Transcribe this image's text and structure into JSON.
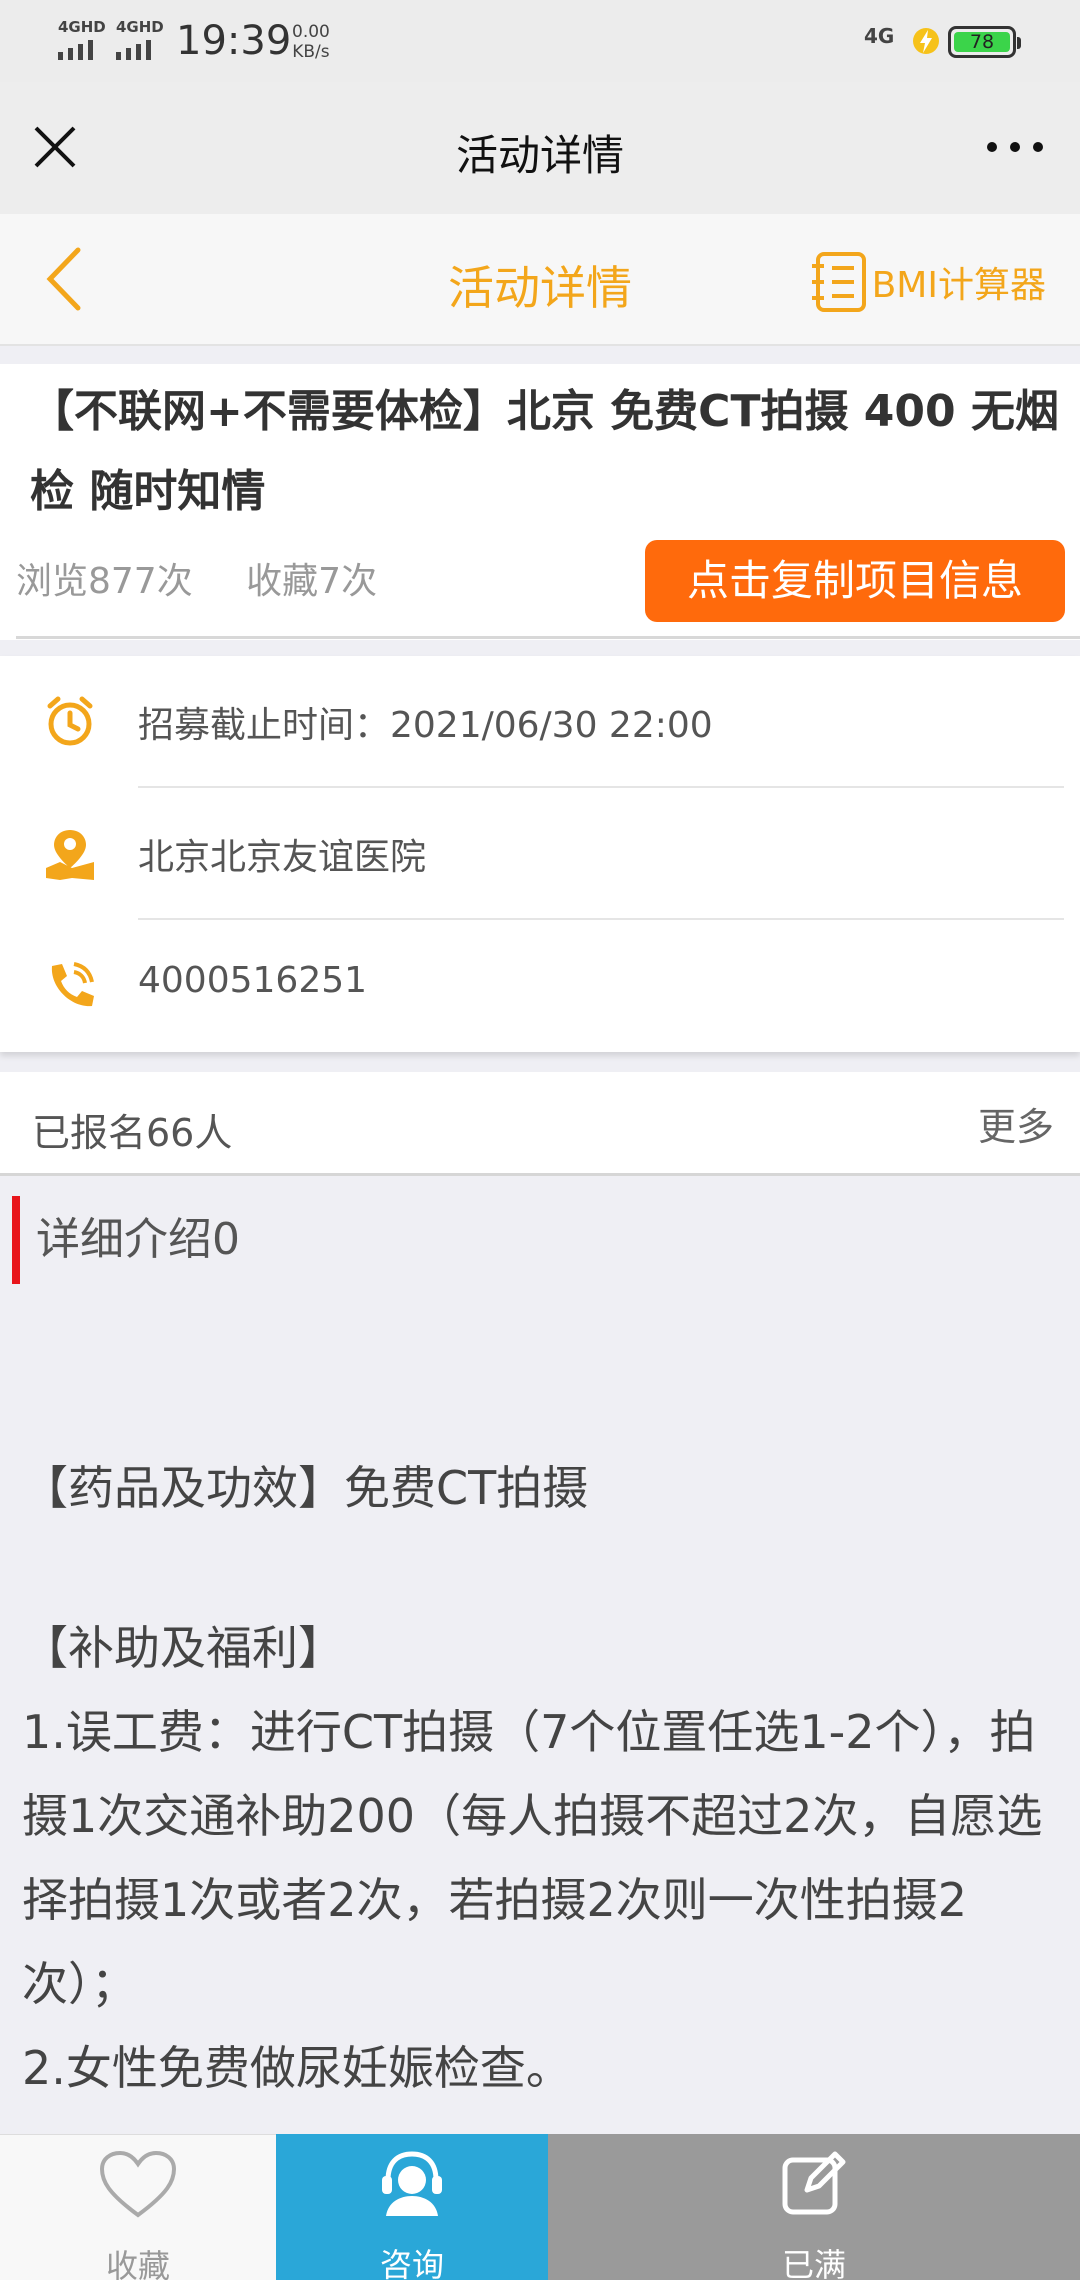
{
  "status": {
    "sim1": "4GHD",
    "sim2": "4GHD",
    "time": "19:39",
    "speed_value": "0.00",
    "speed_unit": "KB/s",
    "network": "4G",
    "battery": "78"
  },
  "wechat_bar": {
    "title": "活动详情"
  },
  "app_header": {
    "title": "活动详情",
    "bmi_label": "BMI计算器"
  },
  "project": {
    "title": "【不联网+不需要体检】北京 免费CT拍摄 400 无烟检 随时知情",
    "views": "浏览877次",
    "favorites": "收藏7次",
    "copy_button": "点击复制项目信息"
  },
  "info": {
    "deadline": "招募截止时间：2021/06/30 22:00",
    "location": "北京北京友谊医院",
    "phone": "4000516251"
  },
  "signup": {
    "count": "已报名66人",
    "more": "更多"
  },
  "details": {
    "heading": "详细介绍0",
    "drug": "【药品及功效】免费CT拍摄",
    "subsidy_heading": "【补助及福利】",
    "item1": "1.误工费：进行CT拍摄（7个位置任选1-2个），拍摄1次交通补助200（每人拍摄不超过2次，自愿选择拍摄1次或者2次，若拍摄2次则一次性拍摄2次）；",
    "item2": "2.女性免费做尿妊娠检查。"
  },
  "bottom_bar": {
    "favorite": "收藏",
    "consult": "咨询",
    "full": "已满"
  },
  "colors": {
    "accent_orange": "#f3a61b",
    "button_orange": "#ff6a0c",
    "consult_blue": "#2aa7d8",
    "full_gray": "#9a9a9a",
    "section_red": "#e8151b"
  }
}
